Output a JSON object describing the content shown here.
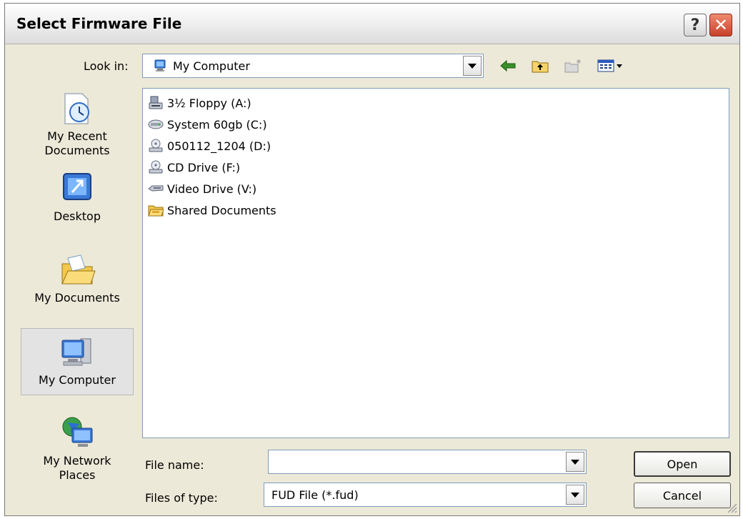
{
  "dialog": {
    "title": "Select Firmware File",
    "help_label": "?",
    "close_label": "✕"
  },
  "lookin": {
    "label": "Look in:",
    "value": "My Computer"
  },
  "toolbar": {
    "back_icon": "back-arrow-icon",
    "up_icon": "up-folder-icon",
    "new_folder_icon": "new-folder-icon",
    "views_icon": "views-menu-icon"
  },
  "places": [
    {
      "label": "My Recent Documents",
      "line1": "My Recent",
      "line2": "Documents"
    },
    {
      "label": "Desktop",
      "line1": "Desktop",
      "line2": ""
    },
    {
      "label": "My Documents",
      "line1": "My Documents",
      "line2": ""
    },
    {
      "label": "My Computer",
      "line1": "My Computer",
      "line2": "",
      "selected": true
    },
    {
      "label": "My Network Places",
      "line1": "My Network",
      "line2": "Places"
    }
  ],
  "files": [
    {
      "name": "3½ Floppy (A:)",
      "icon": "floppy-drive-icon"
    },
    {
      "name": "System 60gb (C:)",
      "icon": "hard-drive-icon"
    },
    {
      "name": "050112_1204 (D:)",
      "icon": "cd-drive-icon"
    },
    {
      "name": "CD Drive (F:)",
      "icon": "cd-drive-icon"
    },
    {
      "name": "Video Drive (V:)",
      "icon": "removable-drive-icon"
    },
    {
      "name": "Shared Documents",
      "icon": "shared-folder-icon"
    }
  ],
  "filename": {
    "label": "File name:",
    "value": ""
  },
  "filetype": {
    "label": "Files of type:",
    "value": "FUD File (*.fud)"
  },
  "buttons": {
    "open": "Open",
    "cancel": "Cancel"
  }
}
